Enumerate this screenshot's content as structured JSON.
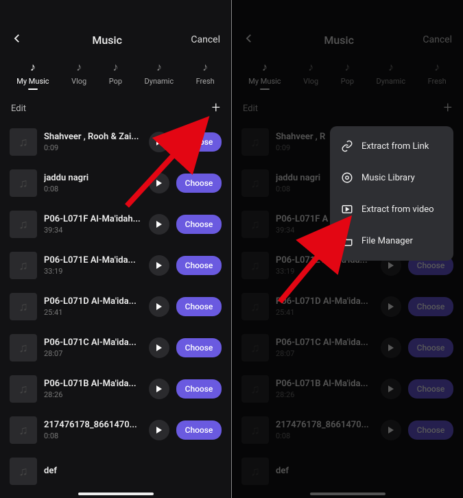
{
  "header": {
    "title": "Music",
    "cancel": "Cancel"
  },
  "tabs": [
    {
      "label": "My Music",
      "active": true
    },
    {
      "label": "Vlog",
      "active": false
    },
    {
      "label": "Pop",
      "active": false
    },
    {
      "label": "Dynamic",
      "active": false
    },
    {
      "label": "Fresh",
      "active": false
    }
  ],
  "listhead": {
    "edit": "Edit"
  },
  "choose_label": "Choose",
  "tracks": [
    {
      "name": "Shahveer , Rooh & Zai...",
      "dur": "0:09"
    },
    {
      "name": "jaddu nagri",
      "dur": "0:08"
    },
    {
      "name": "P06-L071F Al-Ma'idah...",
      "dur": "39:34"
    },
    {
      "name": "P06-L071E Al-Ma'ida...",
      "dur": "33:19"
    },
    {
      "name": "P06-L071D Al-Ma'ida...",
      "dur": "25:41"
    },
    {
      "name": "P06-L071C Al-Ma'ida...",
      "dur": "28:07"
    },
    {
      "name": "P06-L071B Al-Ma'ida...",
      "dur": "28:26"
    },
    {
      "name": "217476178_8661470...",
      "dur": "0:08"
    },
    {
      "name": "def",
      "dur": ""
    }
  ],
  "tracks_right": [
    {
      "name": "Shahveer , R",
      "dur": "0:09"
    },
    {
      "name": "jaddu nagri",
      "dur": "0:08"
    },
    {
      "name": "P06-L071F A",
      "dur": "39:34"
    },
    {
      "name": "P06-L071E Al-Ma'ida...",
      "dur": "33:19"
    },
    {
      "name": "P06-L071D Al-Ma'ida...",
      "dur": "25:41"
    },
    {
      "name": "P06-L071C Al-Ma'ida...",
      "dur": "28:07"
    },
    {
      "name": "P06-L071B Al-Ma'ida...",
      "dur": "28:26"
    },
    {
      "name": "217476178_8661470...",
      "dur": "0:08"
    },
    {
      "name": "def",
      "dur": ""
    }
  ],
  "popup": [
    {
      "label": "Extract from Link"
    },
    {
      "label": "Music Library"
    },
    {
      "label": "Extract from video"
    },
    {
      "label": "File Manager"
    }
  ]
}
